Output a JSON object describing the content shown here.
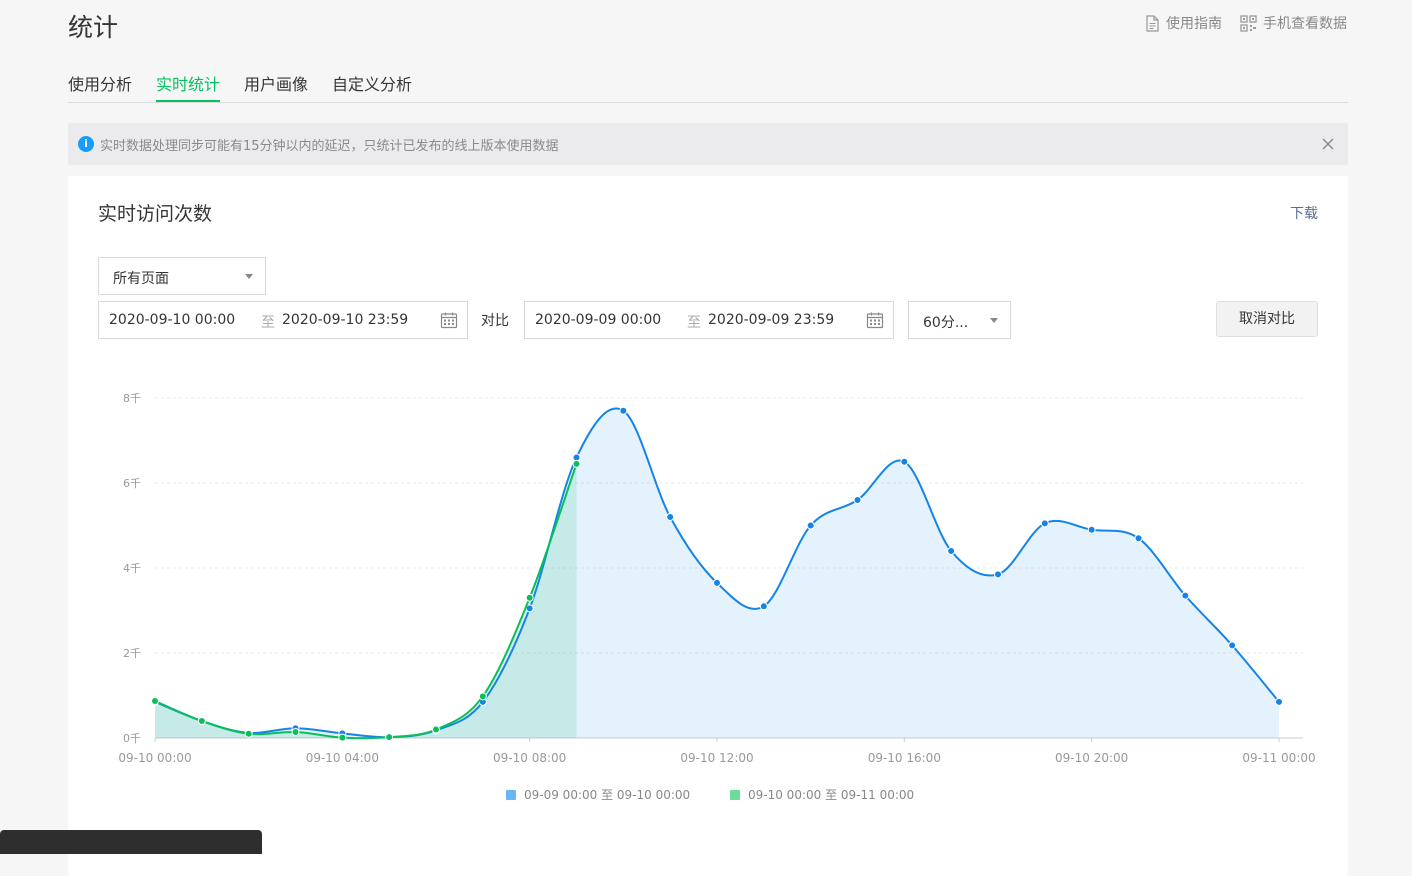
{
  "header": {
    "title": "统计"
  },
  "top_links": {
    "guide": "使用指南",
    "mobile": "手机查看数据"
  },
  "tabs": [
    {
      "label": "使用分析"
    },
    {
      "label": "实时统计"
    },
    {
      "label": "用户画像"
    },
    {
      "label": "自定义分析"
    }
  ],
  "notice": {
    "icon": "info-icon",
    "text": "实时数据处理同步可能有15分钟以内的延迟，只统计已发布的线上版本使用数据"
  },
  "card": {
    "title": "实时访问次数",
    "download": "下载",
    "page_select": "所有页面",
    "range1": {
      "start": "2020-09-10 00:00",
      "to": "至",
      "end": "2020-09-10 23:59"
    },
    "compare_label": "对比",
    "range2": {
      "start": "2020-09-09 00:00",
      "to": "至",
      "end": "2020-09-09 23:59"
    },
    "interval_select": "60分...",
    "cancel_compare": "取消对比"
  },
  "colors": {
    "accent": "#07c160",
    "blue": "#1584e6",
    "green": "#08c05a",
    "link": "#576b95",
    "info": "#1a9dfa"
  },
  "chart_data": {
    "type": "area",
    "x": [
      "09-10 00:00",
      "09-10 01:00",
      "09-10 02:00",
      "09-10 03:00",
      "09-10 04:00",
      "09-10 05:00",
      "09-10 06:00",
      "09-10 07:00",
      "09-10 08:00",
      "09-10 09:00",
      "09-10 10:00",
      "09-10 11:00",
      "09-10 12:00",
      "09-10 13:00",
      "09-10 14:00",
      "09-10 15:00",
      "09-10 16:00",
      "09-10 17:00",
      "09-10 18:00",
      "09-10 19:00",
      "09-10 20:00",
      "09-10 21:00",
      "09-10 22:00",
      "09-10 23:00",
      "09-11 00:00"
    ],
    "x_tick_labels": [
      "09-10 00:00",
      "09-10 04:00",
      "09-10 08:00",
      "09-10 12:00",
      "09-10 16:00",
      "09-10 20:00",
      "09-11 00:00"
    ],
    "y_tick_labels": [
      "0千",
      "2千",
      "4千",
      "6千",
      "8千"
    ],
    "ylim": [
      0,
      8000
    ],
    "grid": true,
    "legend_position": "bottom",
    "series": [
      {
        "name": "09-09 00:00 至 09-10 00:00",
        "color": "#1584e6",
        "values": [
          850,
          400,
          120,
          230,
          110,
          20,
          180,
          850,
          3050,
          6600,
          7700,
          5200,
          3650,
          3100,
          5000,
          5600,
          6500,
          4400,
          3850,
          5050,
          4900,
          4700,
          3350,
          2180,
          850
        ]
      },
      {
        "name": "09-10 00:00 至 09-11 00:00",
        "color": "#08c05a",
        "values": [
          870,
          400,
          100,
          140,
          10,
          20,
          200,
          980,
          3300,
          6450
        ]
      }
    ]
  }
}
